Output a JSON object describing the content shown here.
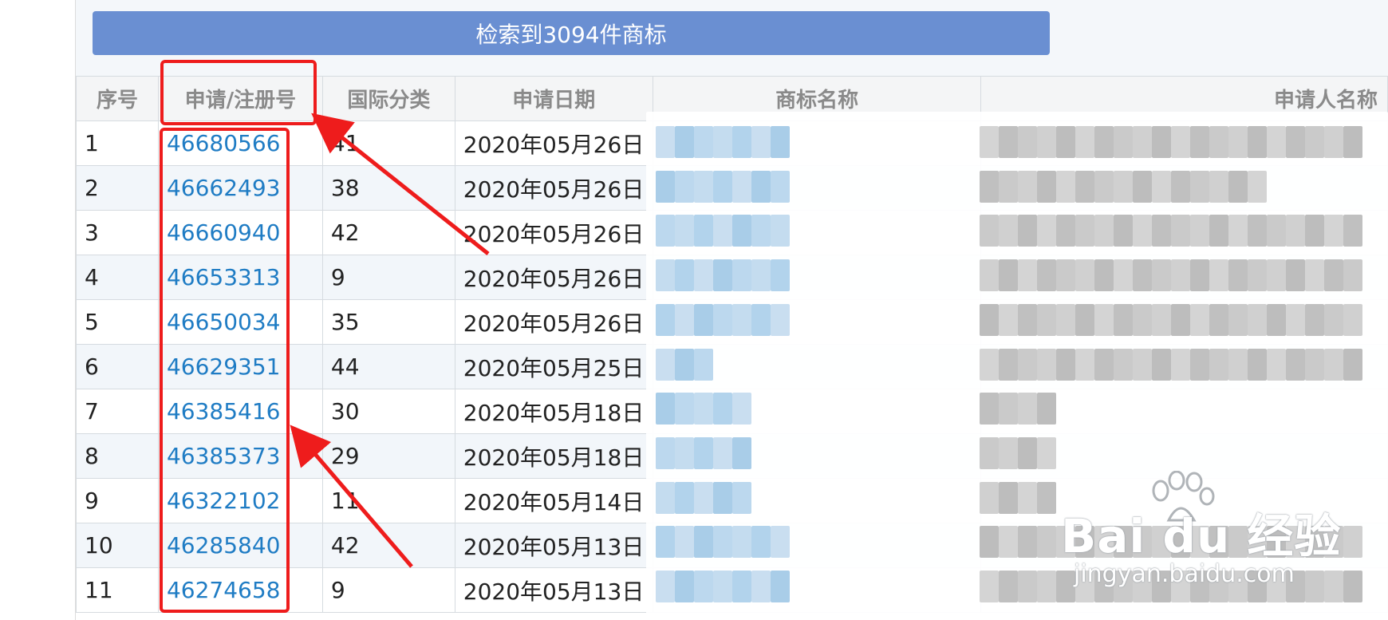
{
  "result_banner": "检索到3094件商标",
  "table": {
    "headers": [
      "序号",
      "申请/注册号",
      "国际分类",
      "申请日期",
      "商标名称",
      "申请人名称"
    ],
    "rows": [
      {
        "seq": "1",
        "reg_no": "46680566",
        "class": "41",
        "date": "2020年05月26日"
      },
      {
        "seq": "2",
        "reg_no": "46662493",
        "class": "38",
        "date": "2020年05月26日"
      },
      {
        "seq": "3",
        "reg_no": "46660940",
        "class": "42",
        "date": "2020年05月26日"
      },
      {
        "seq": "4",
        "reg_no": "46653313",
        "class": "9",
        "date": "2020年05月26日"
      },
      {
        "seq": "5",
        "reg_no": "46650034",
        "class": "35",
        "date": "2020年05月26日"
      },
      {
        "seq": "6",
        "reg_no": "46629351",
        "class": "44",
        "date": "2020年05月25日"
      },
      {
        "seq": "7",
        "reg_no": "46385416",
        "class": "30",
        "date": "2020年05月18日"
      },
      {
        "seq": "8",
        "reg_no": "46385373",
        "class": "29",
        "date": "2020年05月18日"
      },
      {
        "seq": "9",
        "reg_no": "46322102",
        "class": "11",
        "date": "2020年05月14日"
      },
      {
        "seq": "10",
        "reg_no": "46285840",
        "class": "42",
        "date": "2020年05月13日"
      },
      {
        "seq": "11",
        "reg_no": "46274658",
        "class": "9",
        "date": "2020年05月13日"
      }
    ]
  },
  "watermark": {
    "brand": "Bai du 经验",
    "url": "jingyan.baidu.com"
  },
  "colors": {
    "banner": "#6a8fd2",
    "link": "#1f7cc4",
    "annotation": "#ee1c1c"
  }
}
